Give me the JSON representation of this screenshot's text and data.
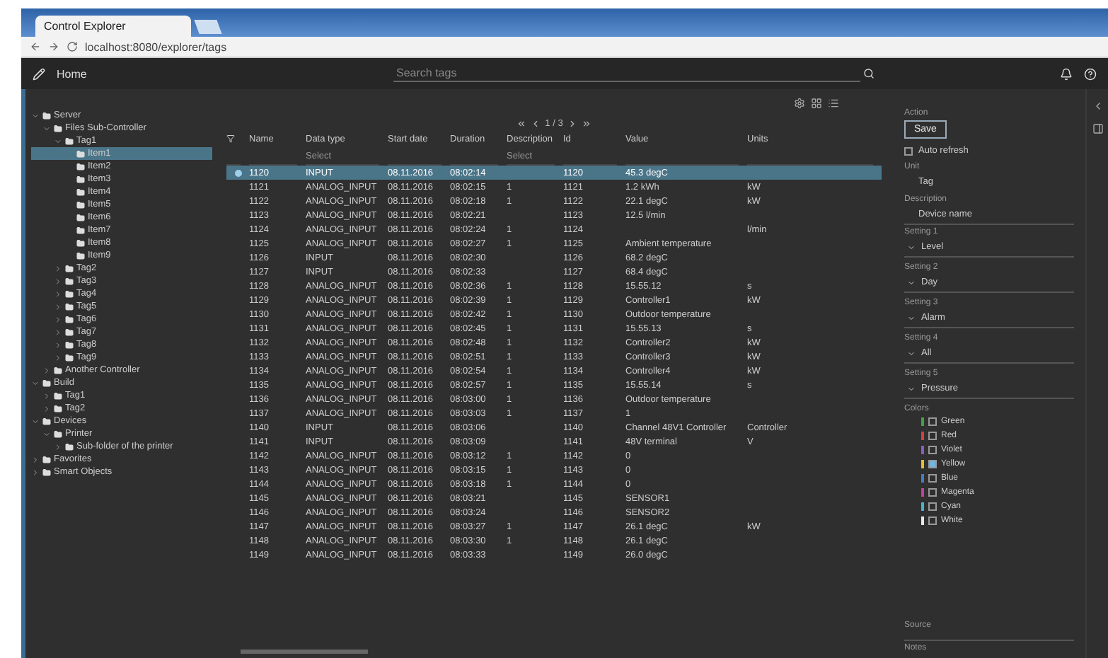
{
  "browser": {
    "tab_title": "Control Explorer",
    "address": "localhost:8080/explorer/tags"
  },
  "app": {
    "title": "Home",
    "search": {
      "placeholder": "Search tags"
    }
  },
  "tree": [
    {
      "label": "Server",
      "expanded": true,
      "selected": false,
      "children": [
        {
          "label": "Files Sub-Controller",
          "expanded": true,
          "selected": false,
          "children": [
            {
              "label": "Tag1",
              "expanded": true,
              "selected": false,
              "children": [
                {
                  "label": "Item1",
                  "selected": true
                },
                {
                  "label": "Item2",
                  "selected": false
                },
                {
                  "label": "Item3",
                  "selected": false
                },
                {
                  "label": "Item4",
                  "selected": false
                },
                {
                  "label": "Item5",
                  "selected": false
                },
                {
                  "label": "Item6",
                  "selected": false
                },
                {
                  "label": "Item7",
                  "selected": false
                },
                {
                  "label": "Item8",
                  "selected": false
                },
                {
                  "label": "Item9",
                  "selected": false
                }
              ]
            },
            {
              "label": "Tag2",
              "expanded": false,
              "selected": false
            },
            {
              "label": "Tag3",
              "expanded": false,
              "selected": false
            },
            {
              "label": "Tag4",
              "expanded": false,
              "selected": false
            },
            {
              "label": "Tag5",
              "expanded": false,
              "selected": false
            },
            {
              "label": "Tag6",
              "expanded": false,
              "selected": false
            },
            {
              "label": "Tag7",
              "expanded": false,
              "selected": false
            },
            {
              "label": "Tag8",
              "expanded": false,
              "selected": false
            },
            {
              "label": "Tag9",
              "expanded": false,
              "selected": false
            }
          ]
        },
        {
          "label": "Another Controller",
          "expanded": false,
          "selected": false
        }
      ]
    },
    {
      "label": "Build",
      "expanded": true,
      "selected": false,
      "children": [
        {
          "label": "Tag1",
          "expanded": false,
          "selected": false
        },
        {
          "label": "Tag2",
          "expanded": false,
          "selected": false
        }
      ]
    },
    {
      "label": "Devices",
      "expanded": true,
      "selected": false,
      "children": [
        {
          "label": "Printer",
          "expanded": true,
          "selected": false,
          "children": [
            {
              "label": "Sub-folder of the printer",
              "expanded": false,
              "selected": false
            }
          ]
        }
      ]
    },
    {
      "label": "Favorites",
      "expanded": false,
      "selected": false
    },
    {
      "label": "Smart Objects",
      "expanded": false,
      "selected": false
    }
  ],
  "pager": {
    "label": "1 / 3"
  },
  "table": {
    "columns": [
      {
        "label": "Name"
      },
      {
        "label": "Data type",
        "filter": "Select"
      },
      {
        "label": "Start date"
      },
      {
        "label": "Duration"
      },
      {
        "label": "Description",
        "filter": "Select"
      },
      {
        "label": "Id"
      },
      {
        "label": "Value"
      },
      {
        "label": "Units"
      }
    ],
    "rows": [
      {
        "selected": true,
        "cells": [
          "1120",
          "INPUT",
          "08.11.2016",
          "08:02:14",
          "",
          "1120",
          "45.3 degC",
          ""
        ]
      },
      {
        "selected": false,
        "cells": [
          "1121",
          "ANALOG_INPUT",
          "08.11.2016",
          "08:02:15",
          "1",
          "1121",
          "1.2 kWh",
          "kW"
        ]
      },
      {
        "selected": false,
        "cells": [
          "1122",
          "ANALOG_INPUT",
          "08.11.2016",
          "08:02:18",
          "1",
          "1122",
          "22.1 degC",
          "kW"
        ]
      },
      {
        "selected": false,
        "cells": [
          "1123",
          "ANALOG_INPUT",
          "08.11.2016",
          "08:02:21",
          "",
          "1123",
          "12.5 l/min",
          ""
        ]
      },
      {
        "selected": false,
        "cells": [
          "1124",
          "ANALOG_INPUT",
          "08.11.2016",
          "08:02:24",
          "1",
          "1124",
          "",
          "l/min"
        ]
      },
      {
        "selected": false,
        "cells": [
          "1125",
          "ANALOG_INPUT",
          "08.11.2016",
          "08:02:27",
          "1",
          "1125",
          "Ambient temperature",
          ""
        ]
      },
      {
        "selected": false,
        "cells": [
          "1126",
          "INPUT",
          "08.11.2016",
          "08:02:30",
          "",
          "1126",
          "68.2 degC",
          ""
        ]
      },
      {
        "selected": false,
        "cells": [
          "1127",
          "INPUT",
          "08.11.2016",
          "08:02:33",
          "",
          "1127",
          "68.4 degC",
          ""
        ]
      },
      {
        "selected": false,
        "cells": [
          "1128",
          "ANALOG_INPUT",
          "08.11.2016",
          "08:02:36",
          "1",
          "1128",
          "15.55.12",
          "s"
        ]
      },
      {
        "selected": false,
        "cells": [
          "1129",
          "ANALOG_INPUT",
          "08.11.2016",
          "08:02:39",
          "1",
          "1129",
          "Controller1",
          "kW"
        ]
      },
      {
        "selected": false,
        "cells": [
          "1130",
          "ANALOG_INPUT",
          "08.11.2016",
          "08:02:42",
          "1",
          "1130",
          "Outdoor temperature",
          ""
        ]
      },
      {
        "selected": false,
        "cells": [
          "1131",
          "ANALOG_INPUT",
          "08.11.2016",
          "08:02:45",
          "1",
          "1131",
          "15.55.13",
          "s"
        ]
      },
      {
        "selected": false,
        "cells": [
          "1132",
          "ANALOG_INPUT",
          "08.11.2016",
          "08:02:48",
          "1",
          "1132",
          "Controller2",
          "kW"
        ]
      },
      {
        "selected": false,
        "cells": [
          "1133",
          "ANALOG_INPUT",
          "08.11.2016",
          "08:02:51",
          "1",
          "1133",
          "Controller3",
          "kW"
        ]
      },
      {
        "selected": false,
        "cells": [
          "1134",
          "ANALOG_INPUT",
          "08.11.2016",
          "08:02:54",
          "1",
          "1134",
          "Controller4",
          "kW"
        ]
      },
      {
        "selected": false,
        "cells": [
          "1135",
          "ANALOG_INPUT",
          "08.11.2016",
          "08:02:57",
          "1",
          "1135",
          "15.55.14",
          "s"
        ]
      },
      {
        "selected": false,
        "cells": [
          "1136",
          "ANALOG_INPUT",
          "08.11.2016",
          "08:03:00",
          "1",
          "1136",
          "Outdoor temperature",
          ""
        ]
      },
      {
        "selected": false,
        "cells": [
          "1137",
          "ANALOG_INPUT",
          "08.11.2016",
          "08:03:03",
          "1",
          "1137",
          "1",
          ""
        ]
      },
      {
        "selected": false,
        "cells": [
          "1140",
          "INPUT",
          "08.11.2016",
          "08:03:06",
          "",
          "1140",
          "Channel 48V1 Controller",
          "Controller"
        ]
      },
      {
        "selected": false,
        "cells": [
          "1141",
          "INPUT",
          "08.11.2016",
          "08:03:09",
          "",
          "1141",
          "48V terminal",
          "V"
        ]
      },
      {
        "selected": false,
        "cells": [
          "1142",
          "ANALOG_INPUT",
          "08.11.2016",
          "08:03:12",
          "1",
          "1142",
          "0",
          ""
        ]
      },
      {
        "selected": false,
        "cells": [
          "1143",
          "ANALOG_INPUT",
          "08.11.2016",
          "08:03:15",
          "1",
          "1143",
          "0",
          ""
        ]
      },
      {
        "selected": false,
        "cells": [
          "1144",
          "ANALOG_INPUT",
          "08.11.2016",
          "08:03:18",
          "1",
          "1144",
          "0",
          ""
        ]
      },
      {
        "selected": false,
        "cells": [
          "1145",
          "ANALOG_INPUT",
          "08.11.2016",
          "08:03:21",
          "",
          "1145",
          "SENSOR1",
          ""
        ]
      },
      {
        "selected": false,
        "cells": [
          "1146",
          "ANALOG_INPUT",
          "08.11.2016",
          "08:03:24",
          "",
          "1146",
          "SENSOR2",
          ""
        ]
      },
      {
        "selected": false,
        "cells": [
          "1147",
          "ANALOG_INPUT",
          "08.11.2016",
          "08:03:27",
          "1",
          "1147",
          "26.1 degC",
          "kW"
        ]
      },
      {
        "selected": false,
        "cells": [
          "1148",
          "ANALOG_INPUT",
          "08.11.2016",
          "08:03:30",
          "1",
          "1148",
          "26.1 degC",
          ""
        ]
      },
      {
        "selected": false,
        "cells": [
          "1149",
          "ANALOG_INPUT",
          "08.11.2016",
          "08:03:33",
          "",
          "1149",
          "26.0 degC",
          ""
        ]
      }
    ]
  },
  "panel": {
    "action_label": "Action",
    "save": "Save",
    "auto_refresh": {
      "label": "Auto refresh",
      "checked": false
    },
    "unit": {
      "label": "Unit",
      "value": "Tag"
    },
    "description": {
      "label": "Description",
      "value": "Device name"
    },
    "selects": [
      {
        "label": "Setting 1",
        "value": "Level"
      },
      {
        "label": "Setting 2",
        "value": "Day"
      },
      {
        "label": "Setting 3",
        "value": "Alarm"
      },
      {
        "label": "Setting 4",
        "value": "All"
      },
      {
        "label": "Setting 5",
        "value": "Pressure"
      }
    ],
    "colors_label": "Colors",
    "colors": [
      {
        "label": "Green",
        "checked": false,
        "color": "#3fa34d"
      },
      {
        "label": "Red",
        "checked": false,
        "color": "#d04040"
      },
      {
        "label": "Violet",
        "checked": false,
        "color": "#8a5cc2"
      },
      {
        "label": "Yellow",
        "checked": true,
        "color": "#e0c030"
      },
      {
        "label": "Blue",
        "checked": false,
        "color": "#3f7fd0"
      },
      {
        "label": "Magenta",
        "checked": false,
        "color": "#c0409a"
      },
      {
        "label": "Cyan",
        "checked": false,
        "color": "#40b8c8"
      },
      {
        "label": "White",
        "checked": false,
        "color": "#e8e8e8"
      }
    ],
    "source_label": "Source",
    "notes_label": "Notes"
  }
}
